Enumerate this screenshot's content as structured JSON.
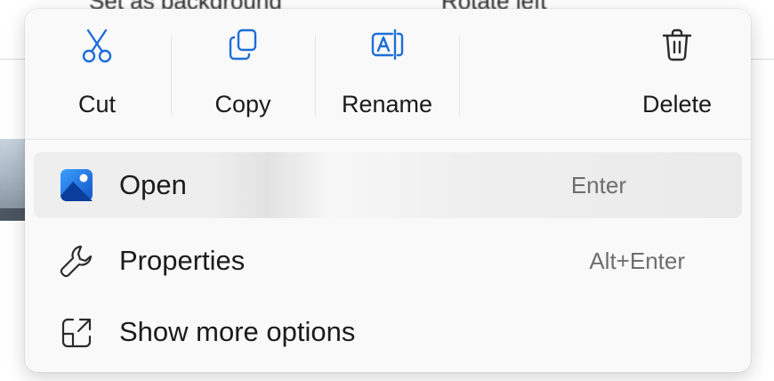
{
  "background": {
    "toolbar_items": [
      {
        "label": "Set as background"
      },
      {
        "label": "Rotate left"
      }
    ]
  },
  "menu": {
    "quick_actions": [
      {
        "label": "Cut",
        "icon": "scissors-icon"
      },
      {
        "label": "Copy",
        "icon": "copy-icon"
      },
      {
        "label": "Rename",
        "icon": "rename-icon"
      },
      {
        "label": "Delete",
        "icon": "trash-icon"
      }
    ],
    "items": [
      {
        "label": "Open",
        "shortcut": "Enter",
        "icon": "photos-app-icon"
      },
      {
        "label": "Properties",
        "shortcut": "Alt+Enter",
        "icon": "wrench-icon"
      },
      {
        "label": "Show more options",
        "shortcut": "",
        "icon": "share-external-icon"
      }
    ]
  },
  "colors": {
    "menu_bg": "#f9f9f9",
    "accent": "#1e6ed8",
    "text": "#1b1b1b",
    "shortcut_text": "#6e6e6e"
  }
}
